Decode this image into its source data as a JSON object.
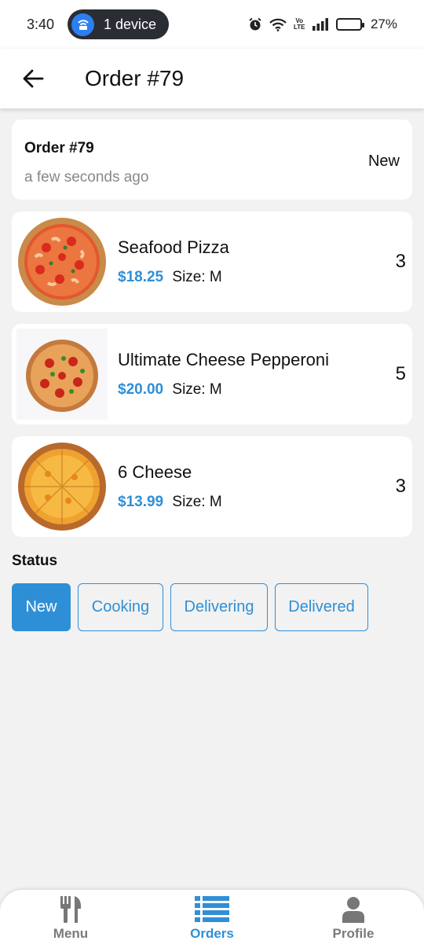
{
  "status_bar": {
    "time": "3:40",
    "pill_text": "1 device",
    "volte": "Vo LTE",
    "battery_percent": "27%",
    "battery_level": 0.27,
    "icons": [
      "alarm-icon",
      "wifi-icon",
      "signal-icon",
      "battery-icon"
    ]
  },
  "app_bar": {
    "back_icon": "arrow-left-icon",
    "title": "Order #79"
  },
  "order": {
    "title": "Order #79",
    "time_ago": "a few seconds ago",
    "status": "New"
  },
  "items": [
    {
      "name": "Seafood Pizza",
      "price": "$18.25",
      "size": "Size: M",
      "quantity": "3",
      "image": "seafood-pizza-image"
    },
    {
      "name": "Ultimate Cheese Pepperoni",
      "price": "$20.00",
      "size": "Size: M",
      "quantity": "5",
      "image": "pepperoni-pizza-image"
    },
    {
      "name": "6 Cheese",
      "price": "$13.99",
      "size": "Size: M",
      "quantity": "3",
      "image": "cheese-pizza-image"
    }
  ],
  "status_section": {
    "label": "Status",
    "options": [
      "New",
      "Cooking",
      "Delivering",
      "Delivered"
    ],
    "selected": "New"
  },
  "bottom_nav": {
    "items": [
      {
        "label": "Menu",
        "icon": "fork-knife-icon"
      },
      {
        "label": "Orders",
        "icon": "list-icon"
      },
      {
        "label": "Profile",
        "icon": "person-icon"
      }
    ],
    "active": "Orders"
  },
  "colors": {
    "accent": "#2f8fd6",
    "background": "#f2f2f2",
    "card": "#ffffff",
    "muted": "#888888"
  }
}
